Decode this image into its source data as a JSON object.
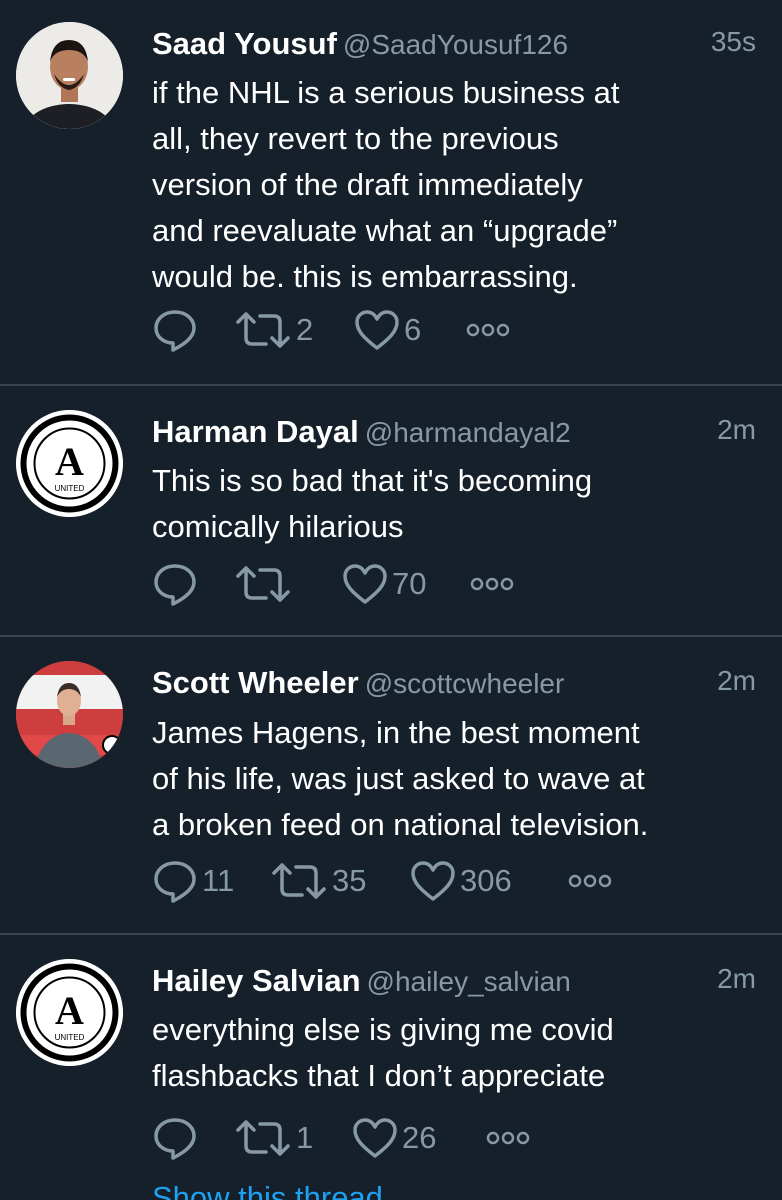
{
  "tweets": [
    {
      "display_name": "Saad Yousuf",
      "handle": "@SaadYousuf126",
      "time": "35s",
      "text": "if the NHL is a serious business at\nall, they revert to the previous\nversion of the draft immediately\nand reevaluate what an “upgrade”\nwould be. this is embarrassing.",
      "replies": "",
      "retweets": "2",
      "likes": "6",
      "avatar": "profile-photo"
    },
    {
      "display_name": "Harman Dayal",
      "handle": "@harmandayal2",
      "time": "2m",
      "text": "This is so bad that it's becoming\ncomically hilarious",
      "replies": "",
      "retweets": "",
      "likes": "70",
      "avatar": "athletic-united-logo",
      "avatar_letter": "A",
      "avatar_sub": "UNITED"
    },
    {
      "display_name": "Scott Wheeler",
      "handle": "@scottcwheeler",
      "time": "2m",
      "text": "James Hagens, in the best moment\nof his life, was just asked to wave at\na broken feed on national television.",
      "replies": "11",
      "retweets": "35",
      "likes": "306",
      "avatar": "profile-photo-red-banner"
    },
    {
      "display_name": "Hailey Salvian",
      "handle": "@hailey_salvian",
      "time": "2m",
      "text": "everything else is giving me covid\nflashbacks that I don’t appreciate",
      "replies": "",
      "retweets": "1",
      "likes": "26",
      "avatar": "athletic-united-logo",
      "avatar_letter": "A",
      "avatar_sub": "UNITED"
    }
  ],
  "show_thread": "Show this thread",
  "colors": {
    "background": "#15202b",
    "divider": "#38444d",
    "secondary_text": "#8899a6",
    "link": "#1da1f2"
  }
}
